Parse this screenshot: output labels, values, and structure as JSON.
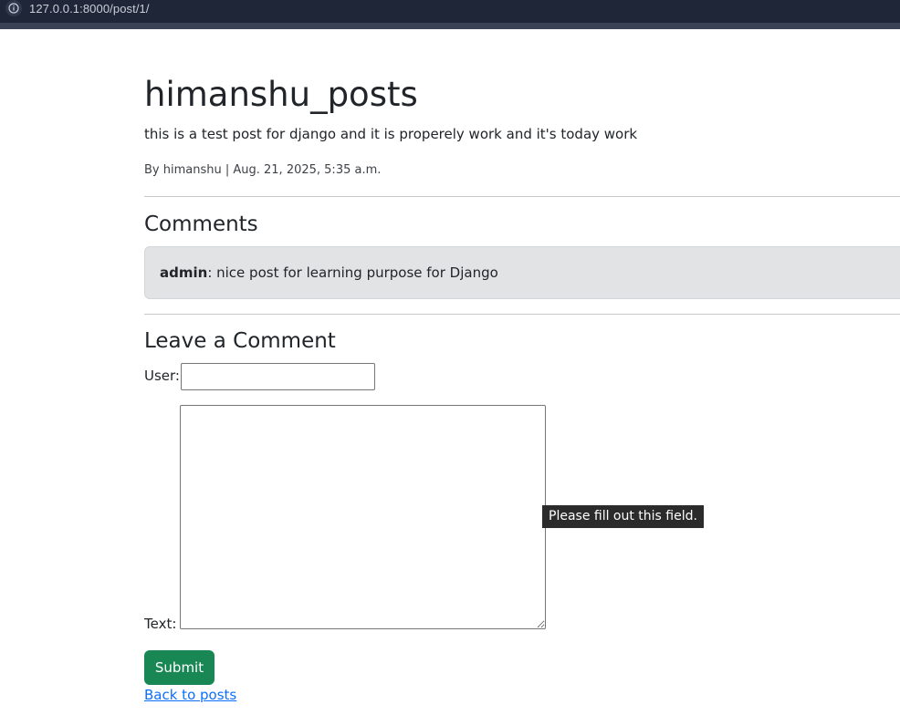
{
  "browser": {
    "url": "127.0.0.1:8000/post/1/",
    "info_icon": "info-icon"
  },
  "post": {
    "title": "himanshu_posts",
    "body": "this is a test post for django and it is properely work and it's today work",
    "meta": "By himanshu | Aug. 21, 2025, 5:35 a.m."
  },
  "comments": {
    "heading": "Comments",
    "items": [
      {
        "author": "admin",
        "text": ": nice post for learning purpose for Django"
      }
    ]
  },
  "form": {
    "heading": "Leave a Comment",
    "user_label": "User:",
    "user_value": "",
    "text_label": "Text:",
    "text_value": "",
    "validation_tooltip": "Please fill out this field.",
    "submit_label": "Submit"
  },
  "nav": {
    "back_label": "Back to posts"
  },
  "colors": {
    "browser_bar": "#1f2638",
    "submit_bg": "#198754",
    "link": "#0d6efd",
    "comment_bg": "#e2e3e5"
  }
}
